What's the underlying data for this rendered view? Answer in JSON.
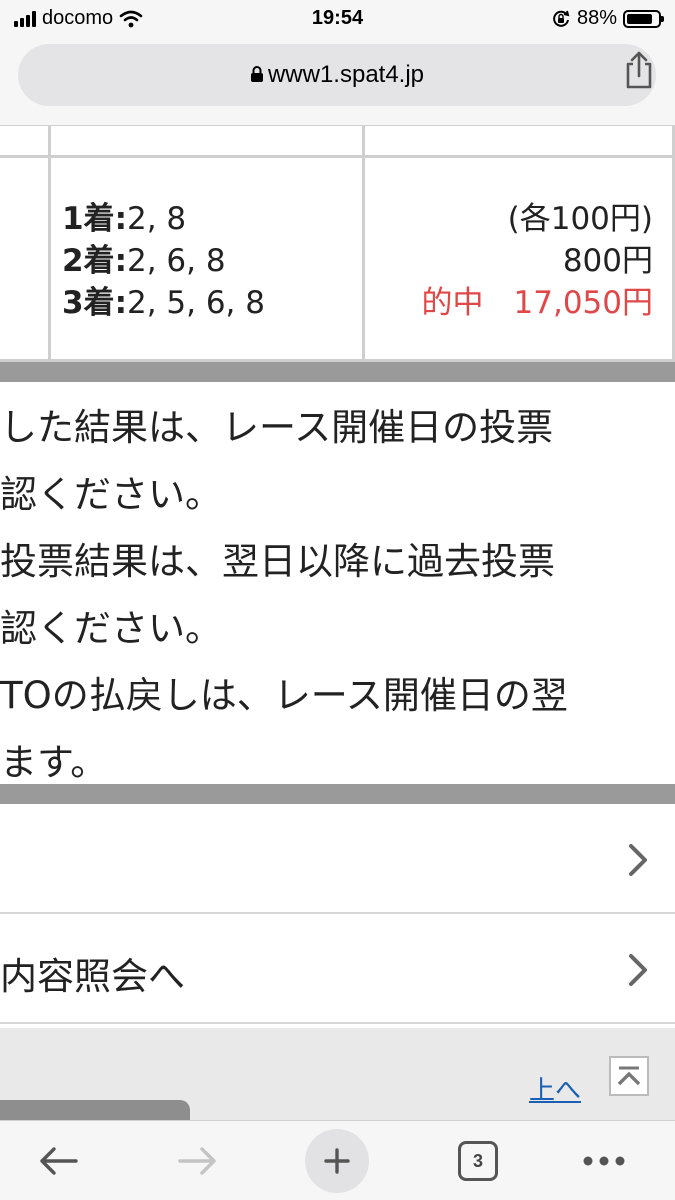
{
  "status_bar": {
    "carrier": "docomo",
    "time": "19:54",
    "battery": "88%",
    "battery_level": 0.88
  },
  "browser": {
    "url": "www1.spat4.jp",
    "tab_count": "3"
  },
  "ticket": {
    "first_label": "1着:",
    "first_value": "2, 8",
    "second_label": "2着:",
    "second_value": "2, 6, 8",
    "third_label": "3着:",
    "third_value": "2, 5, 6, 8",
    "unit_price": "(各100円)",
    "total": "800円",
    "hit_label": "的中",
    "payout": "17,050円",
    "hit_color": "#e04848"
  },
  "notes": [
    "した結果は、レース開催日の投票",
    "認ください。",
    "投票結果は、翌日以降に過去投票",
    "認ください。",
    "TOの払戻しは、レース開催日の翌",
    "ます。"
  ],
  "menu": [
    {
      "label": ""
    },
    {
      "label": "内容照会へ"
    }
  ],
  "page_top": {
    "label": "上へ",
    "link_color": "#1a5fb4"
  }
}
